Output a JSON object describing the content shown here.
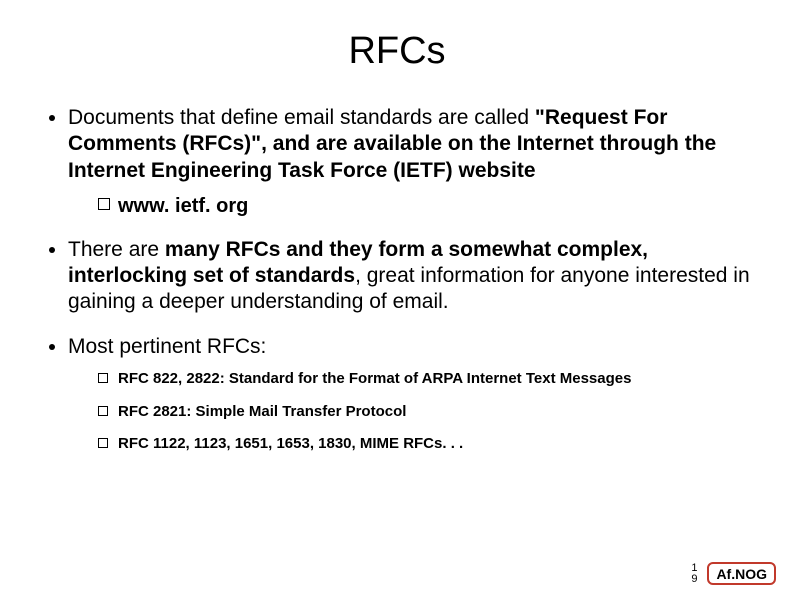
{
  "title": "RFCs",
  "bullets": {
    "b1_pre": "Documents that define email standards are called ",
    "b1_strong": "\"Request For Comments (RFCs)\", and are available on the Internet through the Internet Engineering Task Force (IETF) website",
    "b1_sub1": "www. ietf. org",
    "b2_pre": "There are ",
    "b2_strong": "many RFCs and they form a somewhat complex, interlocking set of standards",
    "b2_post": ", great information for anyone interested in gaining a deeper understanding of email.",
    "b3": "Most pertinent RFCs:",
    "b3_sub1": "RFC 822, 2822: Standard for the Format of ARPA Internet Text Messages",
    "b3_sub2": "RFC 2821: Simple Mail Transfer Protocol",
    "b3_sub3": "RFC 1122, 1123, 1651, 1653, 1830, MIME RFCs. . ."
  },
  "page": {
    "line1": "1",
    "line2": "9"
  },
  "logo": {
    "text": "Af.NOG"
  }
}
